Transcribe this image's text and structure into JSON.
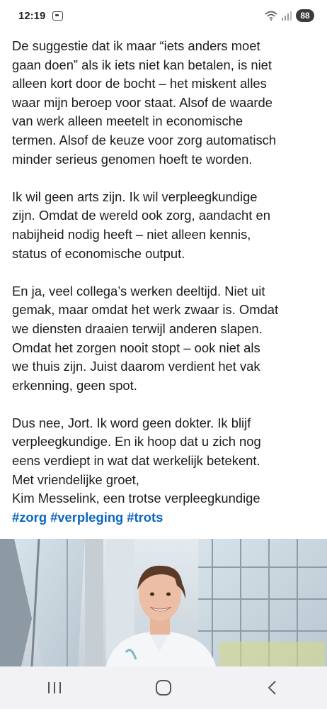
{
  "status_bar": {
    "time": "12:19",
    "battery": "88",
    "icons": [
      "screen-record-icon",
      "wifi-icon",
      "signal-icon"
    ]
  },
  "post": {
    "paragraphs": [
      {
        "lines": [
          "De suggestie dat ik maar “iets anders moet",
          "gaan doen” als ik iets niet kan betalen, is niet",
          "alleen kort door de bocht – het miskent alles",
          "waar mijn beroep voor staat. Alsof de waarde",
          "van werk alleen meetelt in economische",
          "termen. Alsof de keuze voor zorg automatisch",
          "minder serieus genomen hoeft te worden."
        ]
      },
      {
        "lines": [
          "Ik wil geen arts zijn. Ik wil verpleegkundige",
          "zijn. Omdat de wereld ook zorg, aandacht en",
          "nabijheid nodig heeft – niet alleen kennis,",
          "status of economische output."
        ]
      },
      {
        "lines": [
          "En ja, veel collega’s werken deeltijd. Niet uit",
          "gemak, maar omdat het werk zwaar is. Omdat",
          "we diensten draaien terwijl anderen slapen.",
          "Omdat het zorgen nooit stopt – ook niet als",
          "we thuis zijn. Juist daarom verdient het vak",
          "erkenning, geen spot."
        ]
      },
      {
        "lines": [
          "Dus nee, Jort. Ik word geen dokter. Ik blijf",
          "verpleegkundige. En ik hoop dat u zich nog",
          "eens verdiept in wat dat werkelijk betekent.",
          "Met vriendelijke groet,",
          "Kim Messelink, een trotse verpleegkundige"
        ]
      }
    ],
    "hashtags": [
      "#zorg",
      "#verpleging",
      "#trots"
    ]
  },
  "colors": {
    "hashtag": "#0a66c2",
    "text": "#1c1c1c",
    "nav_bar": "#f2f2f4",
    "battery_badge": "#3b3b3b"
  },
  "nav_bar": {
    "buttons": [
      "recent-apps-icon",
      "home-icon",
      "back-icon"
    ]
  }
}
